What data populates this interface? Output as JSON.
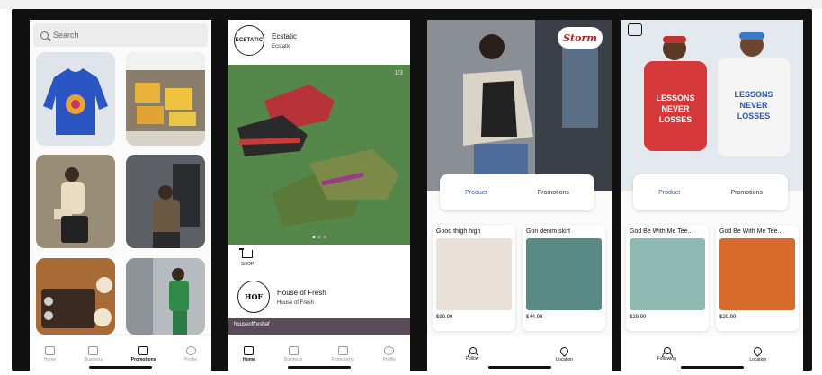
{
  "screens": {
    "discover": {
      "search_placeholder": "Search",
      "tabs": [
        "Home",
        "Business",
        "Promotions",
        "Profile"
      ],
      "active_tab": "Promotions"
    },
    "store_feed": {
      "store1_logo": "ECSTATIC",
      "store1_name": "Ecstatic",
      "store1_sub": "Ecstatic",
      "image_counter": "1/3",
      "shop_label": "SHOP",
      "store2_logo": "HOF",
      "store2_name": "House of Fresh",
      "store2_sub": "House of Fresh",
      "feed_caption": "houseoffreshaf",
      "tabs": [
        "Home",
        "Business",
        "Promotions",
        "Profile"
      ],
      "active_tab": "Home"
    },
    "storm_store": {
      "brand_badge": "Storm",
      "segments": [
        "Product",
        "Promotions"
      ],
      "products": [
        {
          "title": "Good thigh high",
          "price": "$99.99"
        },
        {
          "title": "Gon denim skirt",
          "price": "$44.99"
        }
      ],
      "bottom": [
        "Follow",
        "Location"
      ]
    },
    "gbwm_store": {
      "segments": [
        "Product",
        "Promotions"
      ],
      "hero_text_left": "LESSONS NEVER LOSSES",
      "hero_text_right": "LESSONS NEVER LOSSES",
      "products": [
        {
          "title": "God Be With Me Tee...",
          "price": "$29.99"
        },
        {
          "title": "God Be With Me Tee...",
          "price": "$29.99"
        }
      ],
      "bottom": [
        "Following",
        "Location"
      ]
    }
  },
  "colors": {
    "accent": "#3c5b9b",
    "frame": "#111111"
  }
}
